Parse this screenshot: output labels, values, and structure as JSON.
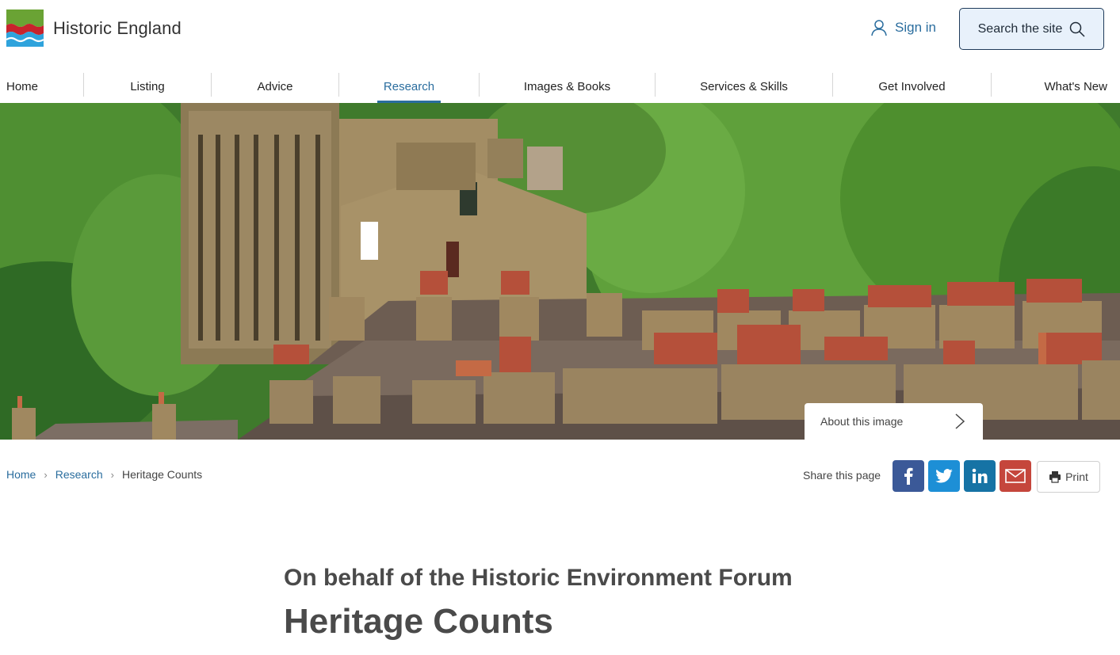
{
  "header": {
    "logo_text": "Historic England",
    "sign_in_label": "Sign in",
    "search_label": "Search the site"
  },
  "nav": {
    "items": [
      {
        "label": "Home"
      },
      {
        "label": "Listing"
      },
      {
        "label": "Advice"
      },
      {
        "label": "Research",
        "active": true
      },
      {
        "label": "Images & Books"
      },
      {
        "label": "Services & Skills"
      },
      {
        "label": "Get Involved"
      },
      {
        "label": "What's New"
      }
    ]
  },
  "hero": {
    "about_label": "About this image"
  },
  "breadcrumb": {
    "home": "Home",
    "research": "Research",
    "current": "Heritage Counts"
  },
  "share": {
    "label": "Share this page",
    "print_label": "Print"
  },
  "page": {
    "subtitle": "On behalf of the Historic Environment Forum",
    "title": "Heritage Counts"
  },
  "colors": {
    "accent": "#2a6d9e",
    "facebook": "#3b5998",
    "twitter": "#1d8fd6",
    "linkedin": "#1673a5",
    "email": "#c5463c"
  }
}
